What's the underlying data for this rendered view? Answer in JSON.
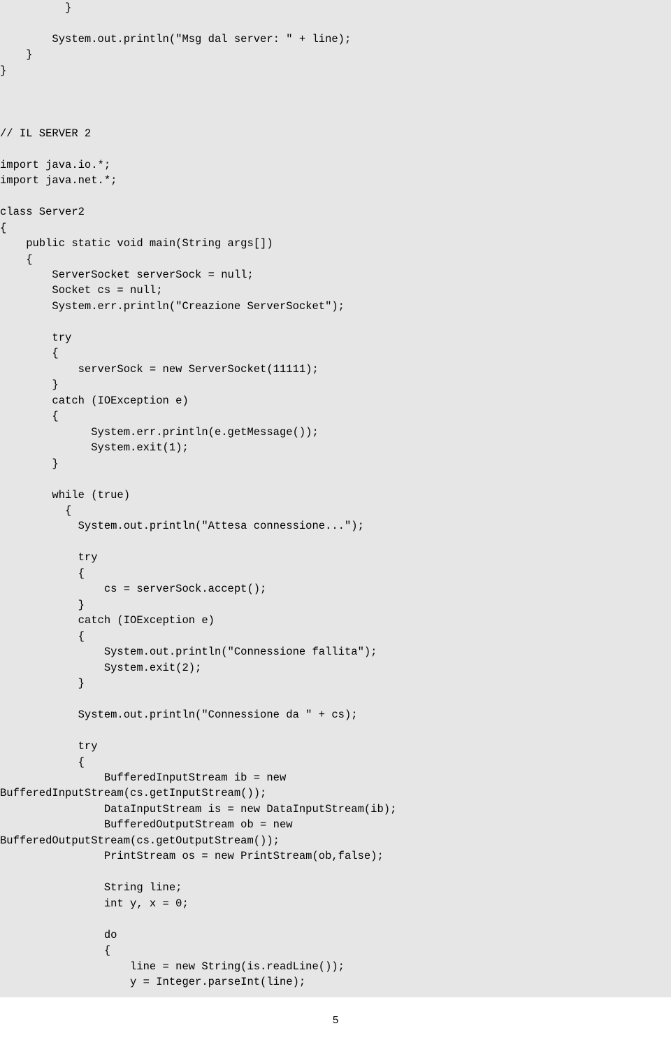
{
  "code": "          }\n\n        System.out.println(\"Msg dal server: \" + line);\n    }\n}\n\n\n\n// IL SERVER 2\n\nimport java.io.*;\nimport java.net.*;\n\nclass Server2\n{\n    public static void main(String args[])\n    {\n        ServerSocket serverSock = null;\n        Socket cs = null;\n        System.err.println(\"Creazione ServerSocket\");\n\n        try\n        {\n            serverSock = new ServerSocket(11111);\n        }\n        catch (IOException e)\n        {\n              System.err.println(e.getMessage());\n              System.exit(1);\n        }\n\n        while (true)\n          {\n            System.out.println(\"Attesa connessione...\");\n\n            try\n            {\n                cs = serverSock.accept();\n            }\n            catch (IOException e)\n            {\n                System.out.println(\"Connessione fallita\");\n                System.exit(2);\n            }\n\n            System.out.println(\"Connessione da \" + cs);\n\n            try\n            {\n                BufferedInputStream ib = new\nBufferedInputStream(cs.getInputStream());\n                DataInputStream is = new DataInputStream(ib);\n                BufferedOutputStream ob = new\nBufferedOutputStream(cs.getOutputStream());\n                PrintStream os = new PrintStream(ob,false);\n\n                String line;\n                int y, x = 0;\n\n                do\n                {\n                    line = new String(is.readLine());\n                    y = Integer.parseInt(line);",
  "page_number": "5"
}
